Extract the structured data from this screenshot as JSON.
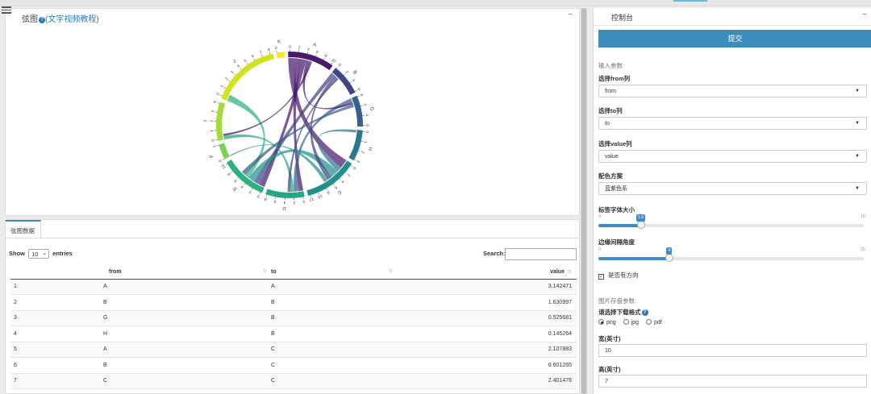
{
  "chart_box": {
    "title_prefix": "弦图",
    "title_link": "(文字视频教程)",
    "collapse": "−"
  },
  "chord": {
    "groups": [
      {
        "name": "A",
        "color": "#481a6c",
        "ticks": [
          "0",
          "2",
          "4",
          "6",
          "8",
          "10"
        ]
      },
      {
        "name": "B",
        "color": "#414487",
        "ticks": [
          "0",
          "2",
          "4",
          "6"
        ]
      },
      {
        "name": "G",
        "color": "#355f8d",
        "ticks": [
          "0",
          "2",
          "4",
          "6"
        ]
      },
      {
        "name": "H",
        "color": "#2a788e",
        "ticks": [
          "0",
          "1",
          "2",
          "3"
        ]
      },
      {
        "name": "C",
        "color": "#21908d",
        "ticks": [
          "0",
          "2",
          "4",
          "6",
          "8",
          "10",
          "12"
        ]
      },
      {
        "name": "D",
        "color": "#22a884",
        "ticks": [
          "0",
          "2",
          "4",
          "6",
          "8"
        ]
      },
      {
        "name": "E",
        "color": "#2cb17e",
        "ticks": [
          "0",
          "2",
          "4",
          "6",
          "8",
          "10"
        ]
      },
      {
        "name": "F",
        "color": "#7ad151",
        "ticks": [
          "0",
          "1"
        ]
      },
      {
        "name": "I",
        "color": "#a5db36",
        "ticks": [
          "0",
          "1",
          "2",
          "3",
          "4"
        ]
      },
      {
        "name": "J",
        "color": "#d2e21b",
        "ticks": [
          "0",
          "1",
          "2",
          "3",
          "4",
          "5",
          "6",
          "7",
          "8"
        ]
      },
      {
        "name": "K",
        "color": "#fde725",
        "ticks": [
          "0"
        ]
      }
    ]
  },
  "table": {
    "tab_label": "弦图数据",
    "show_label": "Show",
    "entries_value": "10",
    "entries_label": "entries",
    "search_label": "Search:",
    "search_value": "",
    "headers": {
      "idx": "",
      "from": "from",
      "to": "to",
      "value": "value"
    },
    "rows": [
      {
        "idx": "1",
        "from": "A",
        "to": "A",
        "value": "3.142471"
      },
      {
        "idx": "2",
        "from": "B",
        "to": "B",
        "value": "1.630997"
      },
      {
        "idx": "3",
        "from": "G",
        "to": "B",
        "value": "0.525681"
      },
      {
        "idx": "4",
        "from": "H",
        "to": "B",
        "value": "0.145264"
      },
      {
        "idx": "5",
        "from": "A",
        "to": "C",
        "value": "2.107883"
      },
      {
        "idx": "6",
        "from": "B",
        "to": "C",
        "value": "0.601265"
      },
      {
        "idx": "7",
        "from": "C",
        "to": "C",
        "value": "2.401476"
      }
    ]
  },
  "panel": {
    "title": "控制台",
    "collapse": "−",
    "submit_label": "提交",
    "input_params_title": "输入参数:",
    "from_label": "选择from列",
    "from_value": "from",
    "to_label": "选择to列",
    "to_value": "to",
    "value_label": "选择value列",
    "value_value": "value",
    "palette_label": "配色方案",
    "palette_value": "蓝紫色系",
    "font_size_label": "标签字体大小",
    "font_size_slider": {
      "min": "0",
      "max": "10",
      "value": 1.6,
      "display": "1.6"
    },
    "gap_label": "边缘间隔角度",
    "gap_slider": {
      "min": "0",
      "max": "15",
      "value": 4,
      "display": "4"
    },
    "directed_label": "是否有方向",
    "directed_checked": true,
    "save_params_title": "图片存盘参数:",
    "format_label": "请选择下载格式",
    "formats": [
      "png",
      "jpg",
      "pdf"
    ],
    "format_selected": "png",
    "width_label": "宽(英寸)",
    "width_value": "10",
    "height_label": "高(英寸)",
    "height_value": "7"
  },
  "icons": {
    "menu": "hamburger-icon",
    "help": "question-circle-icon",
    "caret": "caret-down-icon",
    "sort": "sort-icon"
  }
}
